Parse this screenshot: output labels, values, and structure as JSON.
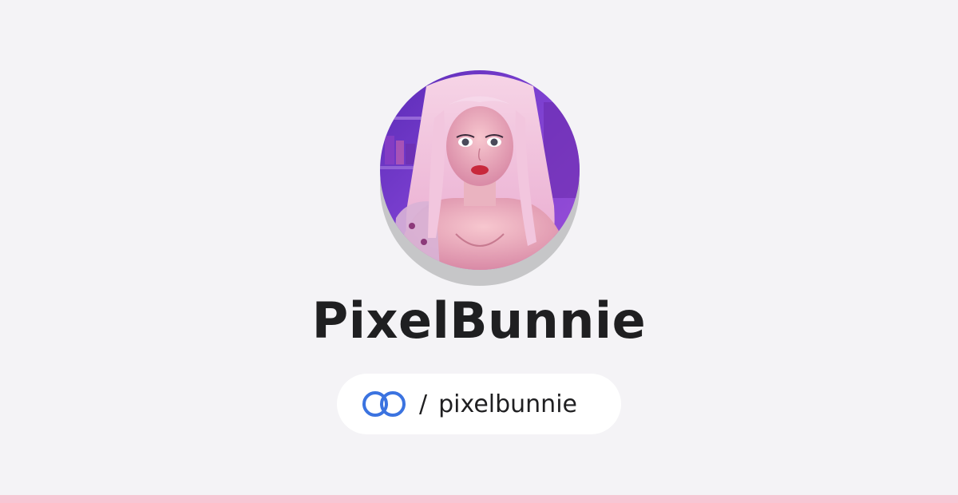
{
  "profile": {
    "display_name": "PixelBunnie",
    "handle_separator": "/",
    "handle": "pixelbunnie",
    "avatar_icon": "profile-photo",
    "brand_icon": "linked-rings-logo"
  },
  "colors": {
    "background": "#f4f3f6",
    "pill_background": "#ffffff",
    "brand_blue": "#3b73e0",
    "text": "#1f1f21",
    "bottom_bar": "#f7c6d4",
    "avatar_shadow": "#c6c6c8"
  }
}
